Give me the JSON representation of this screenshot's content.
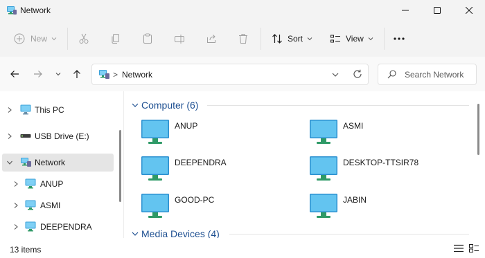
{
  "window": {
    "title": "Network"
  },
  "toolbar": {
    "new_label": "New",
    "sort_label": "Sort",
    "view_label": "View",
    "more_label": "..."
  },
  "address": {
    "path": "Network",
    "separator": ">"
  },
  "search": {
    "placeholder": "Search Network"
  },
  "navigation": {
    "items": [
      {
        "label": "This PC",
        "icon": "pc-icon",
        "expanded": false,
        "selected": false
      },
      {
        "label": "USB Drive (E:)",
        "icon": "usb-drive-icon",
        "expanded": false,
        "selected": false
      },
      {
        "label": "Network",
        "icon": "network-icon",
        "expanded": true,
        "selected": true
      },
      {
        "label": "ANUP",
        "icon": "computer-icon",
        "expanded": false,
        "selected": false
      },
      {
        "label": "ASMI",
        "icon": "computer-icon",
        "expanded": false,
        "selected": false
      },
      {
        "label": "DEEPENDRA",
        "icon": "computer-icon",
        "expanded": false,
        "selected": false
      }
    ]
  },
  "groups": [
    {
      "title": "Computer (6)",
      "items": [
        "ANUP",
        "ASMI",
        "DEEPENDRA",
        "DESKTOP-TTSIR78",
        "GOOD-PC",
        "JABIN"
      ]
    },
    {
      "title": "Media Devices (4)",
      "items": []
    }
  ],
  "status": {
    "item_count": "13 items"
  },
  "colors": {
    "accent": "#1d4f91",
    "selection": "#e5e5e5",
    "monitor_screen": "#3aa0d8",
    "monitor_stand": "#2f9a67"
  }
}
